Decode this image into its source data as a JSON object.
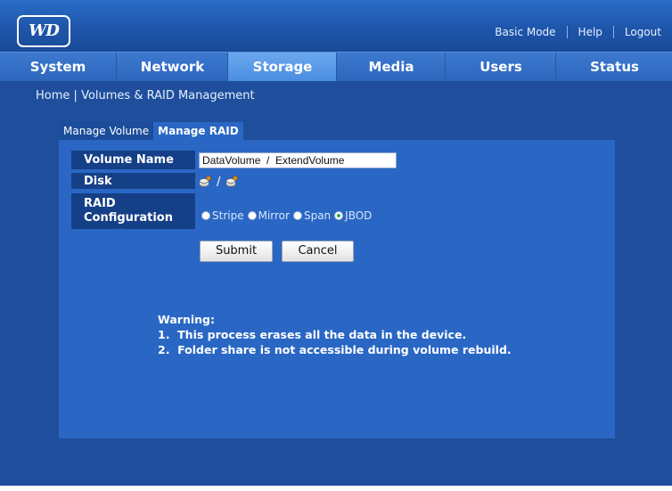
{
  "brand": {
    "logo_text": "WD"
  },
  "top_links": {
    "basic_mode": "Basic Mode",
    "help": "Help",
    "logout": "Logout"
  },
  "nav": {
    "items": [
      {
        "label": "System"
      },
      {
        "label": "Network"
      },
      {
        "label": "Storage",
        "active": true
      },
      {
        "label": "Media"
      },
      {
        "label": "Users"
      },
      {
        "label": "Status"
      }
    ]
  },
  "breadcrumb": {
    "home": "Home",
    "separator": "|",
    "current": "Volumes & RAID Management"
  },
  "tabs": {
    "manage_volume": "Manage Volume",
    "manage_raid": "Manage RAID"
  },
  "form": {
    "volume_name_label": "Volume Name",
    "volume_name_value": "DataVolume  /  ExtendVolume",
    "disk_label": "Disk",
    "disk_separator": "/",
    "raid_label_line1": "RAID",
    "raid_label_line2": "Configuration",
    "raid_options": [
      {
        "label": "Stripe",
        "selected": false
      },
      {
        "label": "Mirror",
        "selected": false
      },
      {
        "label": "Span",
        "selected": false
      },
      {
        "label": "JBOD",
        "selected": true
      }
    ],
    "submit_label": "Submit",
    "cancel_label": "Cancel"
  },
  "warning": {
    "title": "Warning:",
    "line1": "1.  This process erases all the data in the device.",
    "line2": "2.  Folder share is not accessible during volume rebuild."
  },
  "colors": {
    "background": "#1f4f9c",
    "panel": "#2a67c4",
    "label_cell": "#153f87",
    "nav_active": "#4b8ee0",
    "selected_radio": "#2fa84a"
  }
}
